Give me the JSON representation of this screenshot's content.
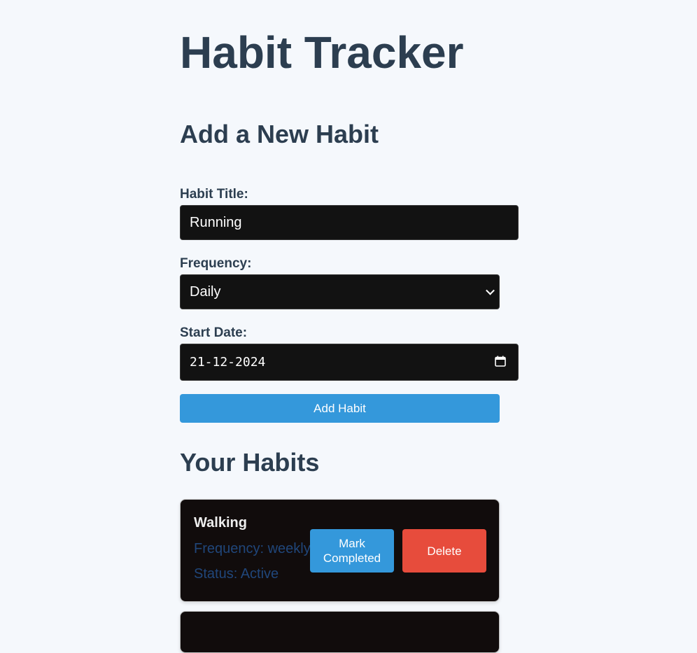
{
  "app": {
    "title": "Habit Tracker"
  },
  "form": {
    "heading": "Add a New Habit",
    "title_label": "Habit Title:",
    "title_value": "Running",
    "frequency_label": "Frequency:",
    "frequency_value": "Daily",
    "start_date_label": "Start Date:",
    "start_date_value": "21-12-2024",
    "submit_label": "Add Habit",
    "icons": {
      "frequency": "chevron-down-icon",
      "date": "calendar-icon"
    },
    "colors": {
      "input_bg": "#121212",
      "submit_bg": "#3498db"
    }
  },
  "habits": {
    "heading": "Your Habits",
    "items": [
      {
        "name": "Walking",
        "frequency": "Frequency: weekly",
        "status": "Status: Active",
        "complete_label": "Mark Completed",
        "delete_label": "Delete"
      }
    ],
    "colors": {
      "card_bg": "#110c0c",
      "complete_bg": "#3498db",
      "delete_bg": "#e74c3c"
    }
  }
}
